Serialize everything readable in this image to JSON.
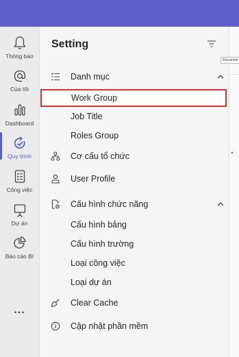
{
  "rail": {
    "items": [
      {
        "label": "Thông báo",
        "icon": "bell-icon"
      },
      {
        "label": "Của tôi",
        "icon": "at-icon"
      },
      {
        "label": "Dashboard",
        "icon": "bar-chart-icon"
      },
      {
        "label": "Quy trình",
        "icon": "workflow-check-icon"
      },
      {
        "label": "Công việc",
        "icon": "task-list-icon"
      },
      {
        "label": "Dự án",
        "icon": "presentation-icon"
      },
      {
        "label": "Báo cáo BI",
        "icon": "pie-report-icon"
      }
    ],
    "more_label": "...",
    "active_index": 3
  },
  "panel": {
    "title": "Setting",
    "items": [
      {
        "label": "Danh mục",
        "icon": "list-icon",
        "type": "group",
        "expanded": true
      },
      {
        "label": "Work Group",
        "type": "child",
        "selected": true
      },
      {
        "label": "Job Title",
        "type": "child"
      },
      {
        "label": "Roles Group",
        "type": "child"
      },
      {
        "label": "Cơ cấu tổ chức",
        "icon": "org-structure-icon",
        "type": "item"
      },
      {
        "label": "User Profile",
        "icon": "person-icon",
        "type": "item"
      },
      {
        "label": "Cấu hình chức năng",
        "icon": "document-settings-icon",
        "type": "group",
        "expanded": true
      },
      {
        "label": "Cấu hình bảng",
        "type": "child"
      },
      {
        "label": "Cấu hình trường",
        "type": "child"
      },
      {
        "label": "Loại công việc",
        "type": "child"
      },
      {
        "label": "Loại dự án",
        "type": "child"
      },
      {
        "label": "Clear Cache",
        "icon": "broom-icon",
        "type": "item"
      },
      {
        "label": "Cập nhật phần mềm",
        "icon": "info-icon",
        "type": "item"
      }
    ]
  },
  "tooltip": "Document",
  "colors": {
    "brand": "#5b5fc7",
    "highlight": "#d13438"
  }
}
